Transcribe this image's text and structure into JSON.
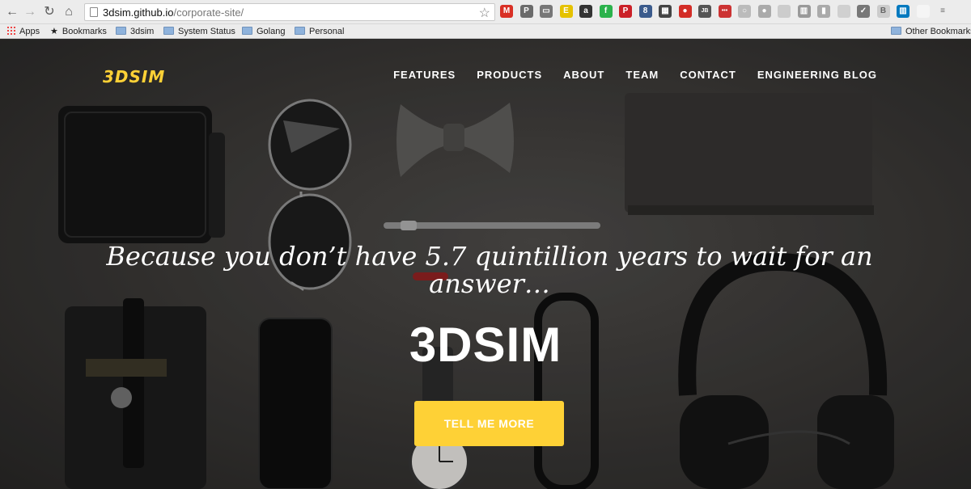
{
  "browser": {
    "url_domain": "3dsim.github.io",
    "url_path": "/corporate-site/",
    "back_icon": "back-arrow-icon",
    "forward_icon": "forward-arrow-icon",
    "reload_icon": "reload-icon",
    "home_icon": "home-icon",
    "extensions": [
      {
        "icon": "gmail-icon",
        "color": "#d93025",
        "glyph": "M"
      },
      {
        "icon": "pocket-icon",
        "color": "#6b6b6b",
        "glyph": "P"
      },
      {
        "icon": "cast-icon",
        "color": "#777777",
        "glyph": "▭"
      },
      {
        "icon": "evernote-icon",
        "color": "#e5c200",
        "glyph": "E"
      },
      {
        "icon": "amazon-icon",
        "color": "#333333",
        "glyph": "a"
      },
      {
        "icon": "feedly-icon",
        "color": "#2bb24c",
        "glyph": "f"
      },
      {
        "icon": "pinterest-icon",
        "color": "#cb2027",
        "glyph": "P"
      },
      {
        "icon": "octopus-icon",
        "color": "#3b5b8c",
        "glyph": "8"
      },
      {
        "icon": "qr-code-icon",
        "color": "#444444",
        "glyph": "▦"
      },
      {
        "icon": "lastpass-icon",
        "color": "#d32d27",
        "glyph": "●"
      },
      {
        "icon": "jb-icon",
        "color": "#555555",
        "glyph": "JB"
      },
      {
        "icon": "dots-icon",
        "color": "#cc3333",
        "glyph": "•••"
      },
      {
        "icon": "circle-icon",
        "color": "#bbbbbb",
        "glyph": "○"
      },
      {
        "icon": "dot-icon",
        "color": "#aaaaaa",
        "glyph": "●"
      },
      {
        "icon": "grey-square-icon",
        "color": "#cccccc",
        "glyph": ""
      },
      {
        "icon": "trello-grey-icon",
        "color": "#999999",
        "glyph": "▥"
      },
      {
        "icon": "mini-chart-icon",
        "color": "#aaaaaa",
        "glyph": "▮"
      },
      {
        "icon": "square-icon",
        "color": "#d0d0d0",
        "glyph": ""
      },
      {
        "icon": "shield-check-icon",
        "color": "#777777",
        "glyph": "✓"
      },
      {
        "icon": "b-icon",
        "color": "#cccccc",
        "glyph": "B"
      },
      {
        "icon": "trello-icon",
        "color": "#0079bf",
        "glyph": "▥"
      },
      {
        "icon": "blank-page-icon",
        "color": "#f5f5f5",
        "glyph": ""
      },
      {
        "icon": "menu-icon",
        "color": "#ececec",
        "glyph": "≡"
      }
    ]
  },
  "bookmarks": {
    "apps": "Apps",
    "items": [
      "Bookmarks",
      "3dsim",
      "System Status",
      "Golang",
      "Personal"
    ],
    "other": "Other Bookmarks"
  },
  "site": {
    "brand": "3DSIM",
    "nav": [
      "FEATURES",
      "PRODUCTS",
      "ABOUT",
      "TEAM",
      "CONTACT",
      "ENGINEERING BLOG"
    ],
    "lead": "Because you don’t have 5.7 quintillion years to wait for an answer…",
    "headline": "3DSIM",
    "cta": "TELL ME MORE"
  },
  "colors": {
    "accent": "#fed136",
    "text": "#ffffff"
  }
}
